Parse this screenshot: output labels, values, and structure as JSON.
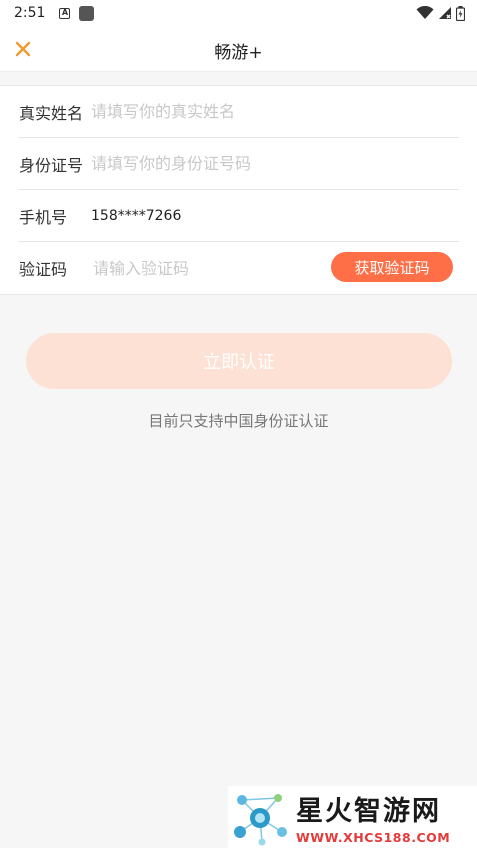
{
  "status_bar": {
    "time": "2:51",
    "icons": [
      "keyboard-a-icon",
      "app-square-icon",
      "wifi-icon",
      "cell-signal-icon",
      "battery-icon"
    ]
  },
  "header": {
    "title": "畅游+",
    "close_icon": "close-icon"
  },
  "form": {
    "name": {
      "label": "真实姓名",
      "placeholder": "请填写你的真实姓名"
    },
    "id_card": {
      "label": "身份证号",
      "placeholder": "请填写你的身份证号码"
    },
    "phone": {
      "label": "手机号",
      "value": "158****7266"
    },
    "code": {
      "label": "验证码",
      "placeholder": "请输入验证码",
      "button": "获取验证码"
    }
  },
  "submit_label": "立即认证",
  "notice": "目前只支持中国身份证认证",
  "watermark": {
    "name": "星火智游网",
    "url": "WWW.XHCS188.COM"
  },
  "colors": {
    "accent": "#ff6f47",
    "close": "#f39a2e",
    "submit_disabled": "#fde1d4",
    "background": "#f6f6f6"
  }
}
